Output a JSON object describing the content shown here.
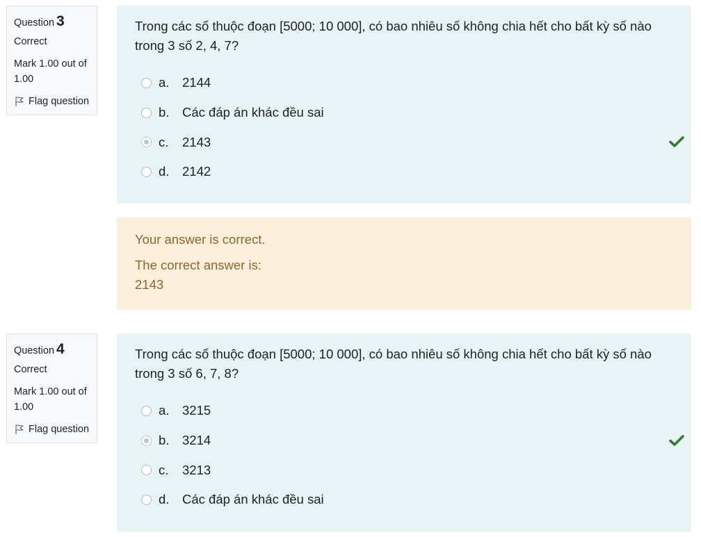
{
  "colors": {
    "formulation_bg": "#e7f3f5",
    "feedback_bg": "#fcefdc",
    "feedback_text": "#8e662e",
    "correct_check": "#357a32"
  },
  "questions": [
    {
      "label": "Question",
      "number": "3",
      "state": "Correct",
      "mark": "Mark 1.00 out of 1.00",
      "flag_label": "Flag question",
      "text": "Trong các số thuộc đoạn [5000; 10 000], có bao nhiêu số không chia hết cho bất kỳ số nào trong 3 số 2, 4, 7?",
      "options": [
        {
          "letter": "a.",
          "text": "2144",
          "selected": false,
          "correct": false
        },
        {
          "letter": "b.",
          "text": "Các đáp án khác đều sai",
          "selected": false,
          "correct": false
        },
        {
          "letter": "c.",
          "text": "2143",
          "selected": true,
          "correct": true
        },
        {
          "letter": "d.",
          "text": "2142",
          "selected": false,
          "correct": false
        }
      ],
      "feedback": {
        "correctness": "Your answer is correct.",
        "right_answer_label": "The correct answer is:",
        "right_answer_value": "2143"
      }
    },
    {
      "label": "Question",
      "number": "4",
      "state": "Correct",
      "mark": "Mark 1.00 out of 1.00",
      "flag_label": "Flag question",
      "text": "Trong các số thuộc đoạn [5000; 10 000], có bao nhiêu số không chia hết cho bất kỳ số nào trong 3 số 6, 7, 8?",
      "options": [
        {
          "letter": "a.",
          "text": "3215",
          "selected": false,
          "correct": false
        },
        {
          "letter": "b.",
          "text": "3214",
          "selected": true,
          "correct": true
        },
        {
          "letter": "c.",
          "text": "3213",
          "selected": false,
          "correct": false
        },
        {
          "letter": "d.",
          "text": "Các đáp án khác đều sai",
          "selected": false,
          "correct": false
        }
      ]
    }
  ]
}
